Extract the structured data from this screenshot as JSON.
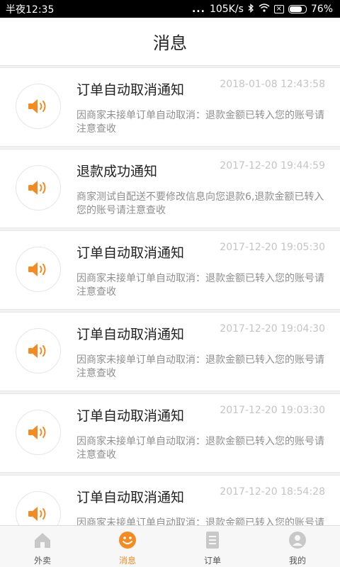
{
  "status_bar": {
    "time": "半夜12:35",
    "dots": "...",
    "net_speed": "105K/s",
    "battery": "76%",
    "battery_level": 0.76,
    "icons": [
      "bluetooth-icon",
      "wifi-icon",
      "sim-off-icon",
      "battery-icon"
    ]
  },
  "header": {
    "title": "消息"
  },
  "messages": [
    {
      "title": "订单自动取消通知",
      "time": "2018-01-08 12:43:58",
      "body": "因商家未接单订单自动取消：退款金额已转入您的账号请注意查收"
    },
    {
      "title": "退款成功通知",
      "time": "2017-12-20 19:44:59",
      "body": "商家测试自配送不要修改信息向您退款6,退款金额已转入您的账号请注意查收"
    },
    {
      "title": "订单自动取消通知",
      "time": "2017-12-20 19:05:30",
      "body": "因商家未接单订单自动取消：退款金额已转入您的账号请注意查收"
    },
    {
      "title": "订单自动取消通知",
      "time": "2017-12-20 19:04:30",
      "body": "因商家未接单订单自动取消：退款金额已转入您的账号请注意查收"
    },
    {
      "title": "订单自动取消通知",
      "time": "2017-12-20 19:03:30",
      "body": "因商家未接单订单自动取消：退款金额已转入您的账号请注意查收"
    },
    {
      "title": "订单自动取消通知",
      "time": "2017-12-20 18:54:28",
      "body": "因商家未接单订单自动取消：退款金额已转入您的账号请注意查收"
    }
  ],
  "tabbar": {
    "items": [
      {
        "label": "外卖",
        "icon": "house-icon",
        "active": false
      },
      {
        "label": "消息",
        "icon": "smile-icon",
        "active": true
      },
      {
        "label": "订单",
        "icon": "document-icon",
        "active": false
      },
      {
        "label": "我的",
        "icon": "person-icon",
        "active": false
      }
    ]
  },
  "colors": {
    "accent": "#f28b22",
    "inactive_icon": "#c8c8c8"
  }
}
